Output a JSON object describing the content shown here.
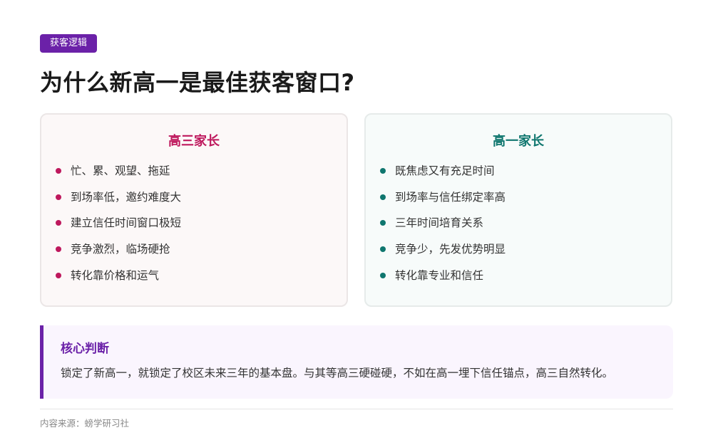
{
  "tag": "获客逻辑",
  "title": "为什么新高一是最佳获客窗口?",
  "cards": [
    {
      "title": "高三家长",
      "accent": "#be185d",
      "items": [
        "忙、累、观望、拖延",
        "到场率低，邀约难度大",
        "建立信任时间窗口极短",
        "竞争激烈，临场硬抢",
        "转化靠价格和运气"
      ]
    },
    {
      "title": "高一家长",
      "accent": "#0f766e",
      "items": [
        "既焦虑又有充足时间",
        "到场率与信任绑定率高",
        "三年时间培育关系",
        "竞争少，先发优势明显",
        "转化靠专业和信任"
      ]
    }
  ],
  "judgement": {
    "title": "核心判断",
    "text": "锁定了新高一，就锁定了校区未来三年的基本盘。与其等高三硬碰硬，不如在高一埋下信任锚点，高三自然转化。",
    "accent": "#6b21a8"
  },
  "source": "内容来源：螃学研习社"
}
